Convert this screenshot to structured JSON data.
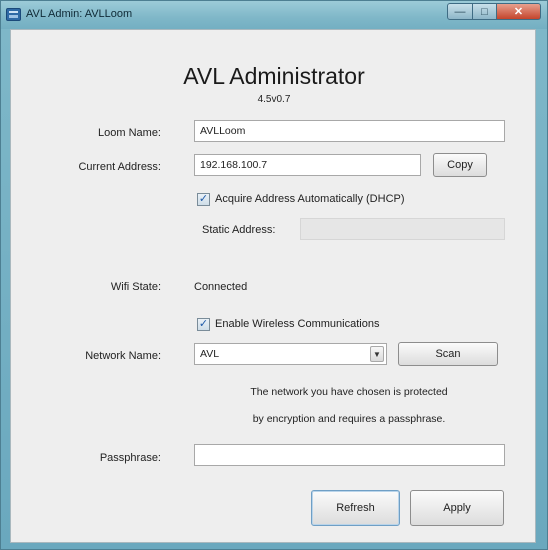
{
  "window": {
    "title": "AVL Admin: AVLLoom"
  },
  "header": {
    "title": "AVL Administrator",
    "version": "4.5v0.7"
  },
  "loom": {
    "label": "Loom Name:",
    "value": "AVLLoom"
  },
  "address": {
    "label": "Current Address:",
    "value": "192.168.100.7",
    "copy_label": "Copy",
    "dhcp_label": "Acquire Address Automatically (DHCP)",
    "dhcp_checked": true,
    "static_label": "Static Address:",
    "static_value": ""
  },
  "wifi": {
    "state_label": "Wifi State:",
    "state_value": "Connected",
    "enable_label": "Enable Wireless Communications",
    "enable_checked": true
  },
  "network": {
    "label": "Network Name:",
    "selected": "AVL",
    "scan_label": "Scan",
    "message_line1": "The network you have chosen is protected",
    "message_line2": "by encryption and requires a passphrase."
  },
  "passphrase": {
    "label": "Passphrase:",
    "value": ""
  },
  "buttons": {
    "refresh": "Refresh",
    "apply": "Apply"
  }
}
